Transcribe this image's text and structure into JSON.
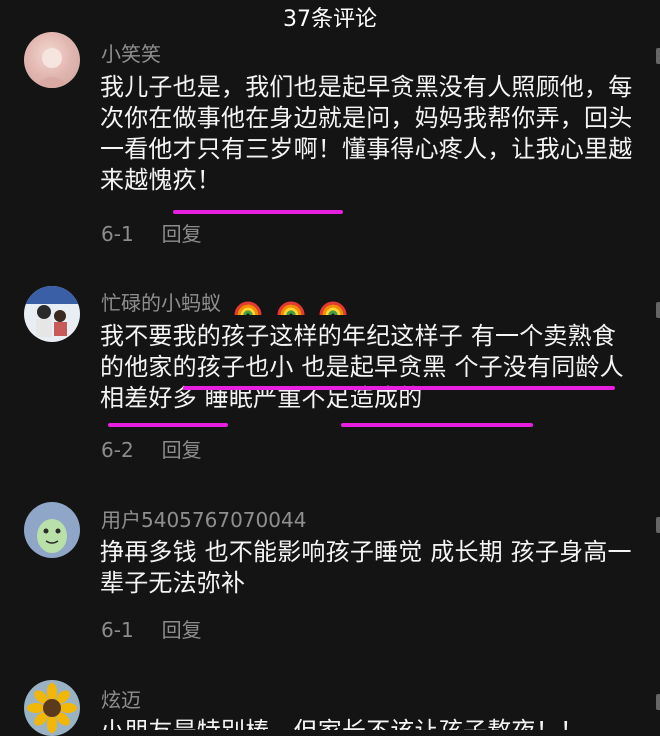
{
  "header": {
    "title": "37条评论"
  },
  "comments": [
    {
      "user": "小笑笑",
      "text": "我儿子也是，我们也是起早贪黑没有人照顾他，每次你在做事他在身边就是问，妈妈我帮你弄，回头一看他才只有三岁啊！懂事得心疼人，让我心里越来越愧疚！",
      "date": "6-1",
      "reply": "回复"
    },
    {
      "user": "忙碌的小蚂蚁",
      "text": "我不要我的孩子这样的年纪这样子 有一个卖熟食的他家的孩子也小 也是起早贪黑 个子没有同龄人 相差好多 睡眠严重不足造成的",
      "date": "6-2",
      "reply": "回复",
      "emoji": [
        "rainbow-emoji",
        "rainbow-emoji",
        "rainbow-emoji"
      ]
    },
    {
      "user": "用户5405767070044",
      "text": "挣再多钱 也不能影响孩子睡觉 成长期 孩子身高一辈子无法弥补",
      "date": "6-1",
      "reply": "回复"
    },
    {
      "user": "炫迈",
      "text": "小朋友是特别棒，但家长不该让孩子熬夜！！"
    }
  ],
  "colors": {
    "background": "#141414",
    "highlight": "#e81fe0",
    "secondary": "#8c8c8c"
  }
}
